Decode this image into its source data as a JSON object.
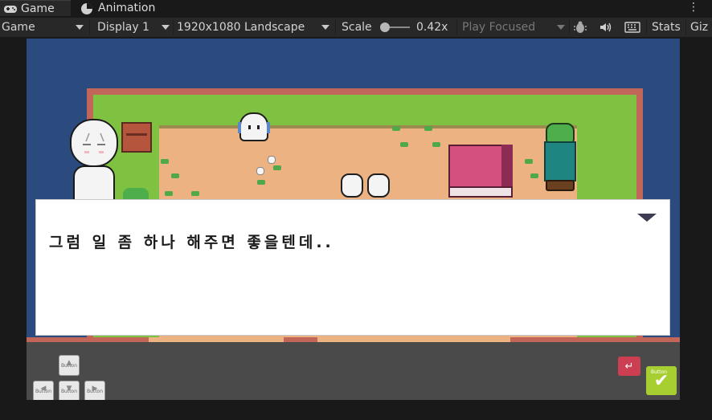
{
  "tabs": {
    "game": "Game",
    "animation": "Animation"
  },
  "toolbar": {
    "view": "Game",
    "display": "Display 1",
    "resolution": "1920x1080 Landscape",
    "scale_label": "Scale",
    "scale_value": "0.42x",
    "play_mode": "Play Focused",
    "stats": "Stats",
    "gizmos": "Giz"
  },
  "dialog": {
    "text": "그럼 일 좀 하나 해주면 좋을텐데.."
  },
  "controls": {
    "button_label": "Button"
  },
  "colors": {
    "editor_bg": "#191919",
    "toolbar_bg": "#282828",
    "game_bg": "#2b4a7e",
    "grass": "#7fc241",
    "dirt": "#ecb282",
    "back_button": "#cc3f52",
    "confirm_button": "#a8cf32"
  },
  "icons": {
    "game_tab": "gamepad-icon",
    "animation_tab": "clock-icon",
    "menu": "kebab-icon",
    "bug": "bug-icon",
    "audio": "speaker-icon",
    "keyboard": "keyboard-icon"
  }
}
